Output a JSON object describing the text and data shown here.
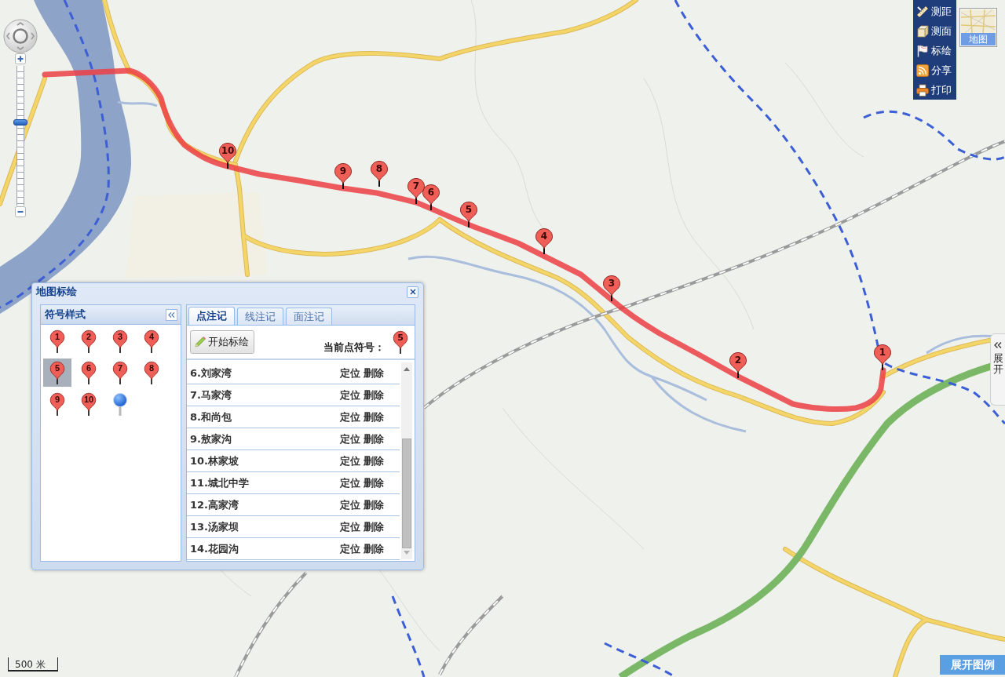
{
  "navigation": {
    "zoom": {
      "level": 0.6
    }
  },
  "toolbar": {
    "items": [
      {
        "label": "测距"
      },
      {
        "label": "测面"
      },
      {
        "label": "标绘"
      },
      {
        "label": "分享"
      },
      {
        "label": "打印"
      }
    ],
    "map_type": {
      "label": "地图"
    }
  },
  "route": {
    "markers": [
      {
        "label": "1"
      },
      {
        "label": "2"
      },
      {
        "label": "3"
      },
      {
        "label": "4"
      },
      {
        "label": "5"
      },
      {
        "label": "6"
      },
      {
        "label": "7"
      },
      {
        "label": "8"
      },
      {
        "label": "9"
      },
      {
        "label": "10"
      }
    ]
  },
  "side_tab": {
    "label": "展开"
  },
  "legend_button": {
    "label": "展开图例"
  },
  "scale": {
    "label": "500 米"
  },
  "panel": {
    "title": "地图标绘",
    "symbol_pane": {
      "title": "符号样式",
      "symbols": [
        {
          "kind": "numbered",
          "label": "1",
          "selected": false
        },
        {
          "kind": "numbered",
          "label": "2",
          "selected": false
        },
        {
          "kind": "numbered",
          "label": "3",
          "selected": false
        },
        {
          "kind": "numbered",
          "label": "4",
          "selected": false
        },
        {
          "kind": "numbered",
          "label": "5",
          "selected": true
        },
        {
          "kind": "numbered",
          "label": "6",
          "selected": false
        },
        {
          "kind": "numbered",
          "label": "7",
          "selected": false
        },
        {
          "kind": "numbered",
          "label": "8",
          "selected": false
        },
        {
          "kind": "numbered",
          "label": "9",
          "selected": false
        },
        {
          "kind": "numbered",
          "label": "10",
          "selected": false
        },
        {
          "kind": "dot",
          "selected": false
        }
      ]
    },
    "tabs": [
      {
        "label": "点注记",
        "selected": true
      },
      {
        "label": "线注记",
        "selected": false
      },
      {
        "label": "面注记",
        "selected": false
      }
    ],
    "start_button": {
      "label": "开始标绘"
    },
    "current_symbol": {
      "label": "当前点符号：",
      "marker": "5"
    },
    "list": [
      {
        "name": "6.刘家湾",
        "locate": "定位",
        "delete": "删除"
      },
      {
        "name": "7.马家湾",
        "locate": "定位",
        "delete": "删除"
      },
      {
        "name": "8.和尚包",
        "locate": "定位",
        "delete": "删除"
      },
      {
        "name": "9.敖家沟",
        "locate": "定位",
        "delete": "删除"
      },
      {
        "name": "10.林家坡",
        "locate": "定位",
        "delete": "删除"
      },
      {
        "name": "11.城北中学",
        "locate": "定位",
        "delete": "删除"
      },
      {
        "name": "12.高家湾",
        "locate": "定位",
        "delete": "删除"
      },
      {
        "name": "13.汤家坝",
        "locate": "定位",
        "delete": "删除"
      },
      {
        "name": "14.花园沟",
        "locate": "定位",
        "delete": "删除"
      }
    ]
  }
}
